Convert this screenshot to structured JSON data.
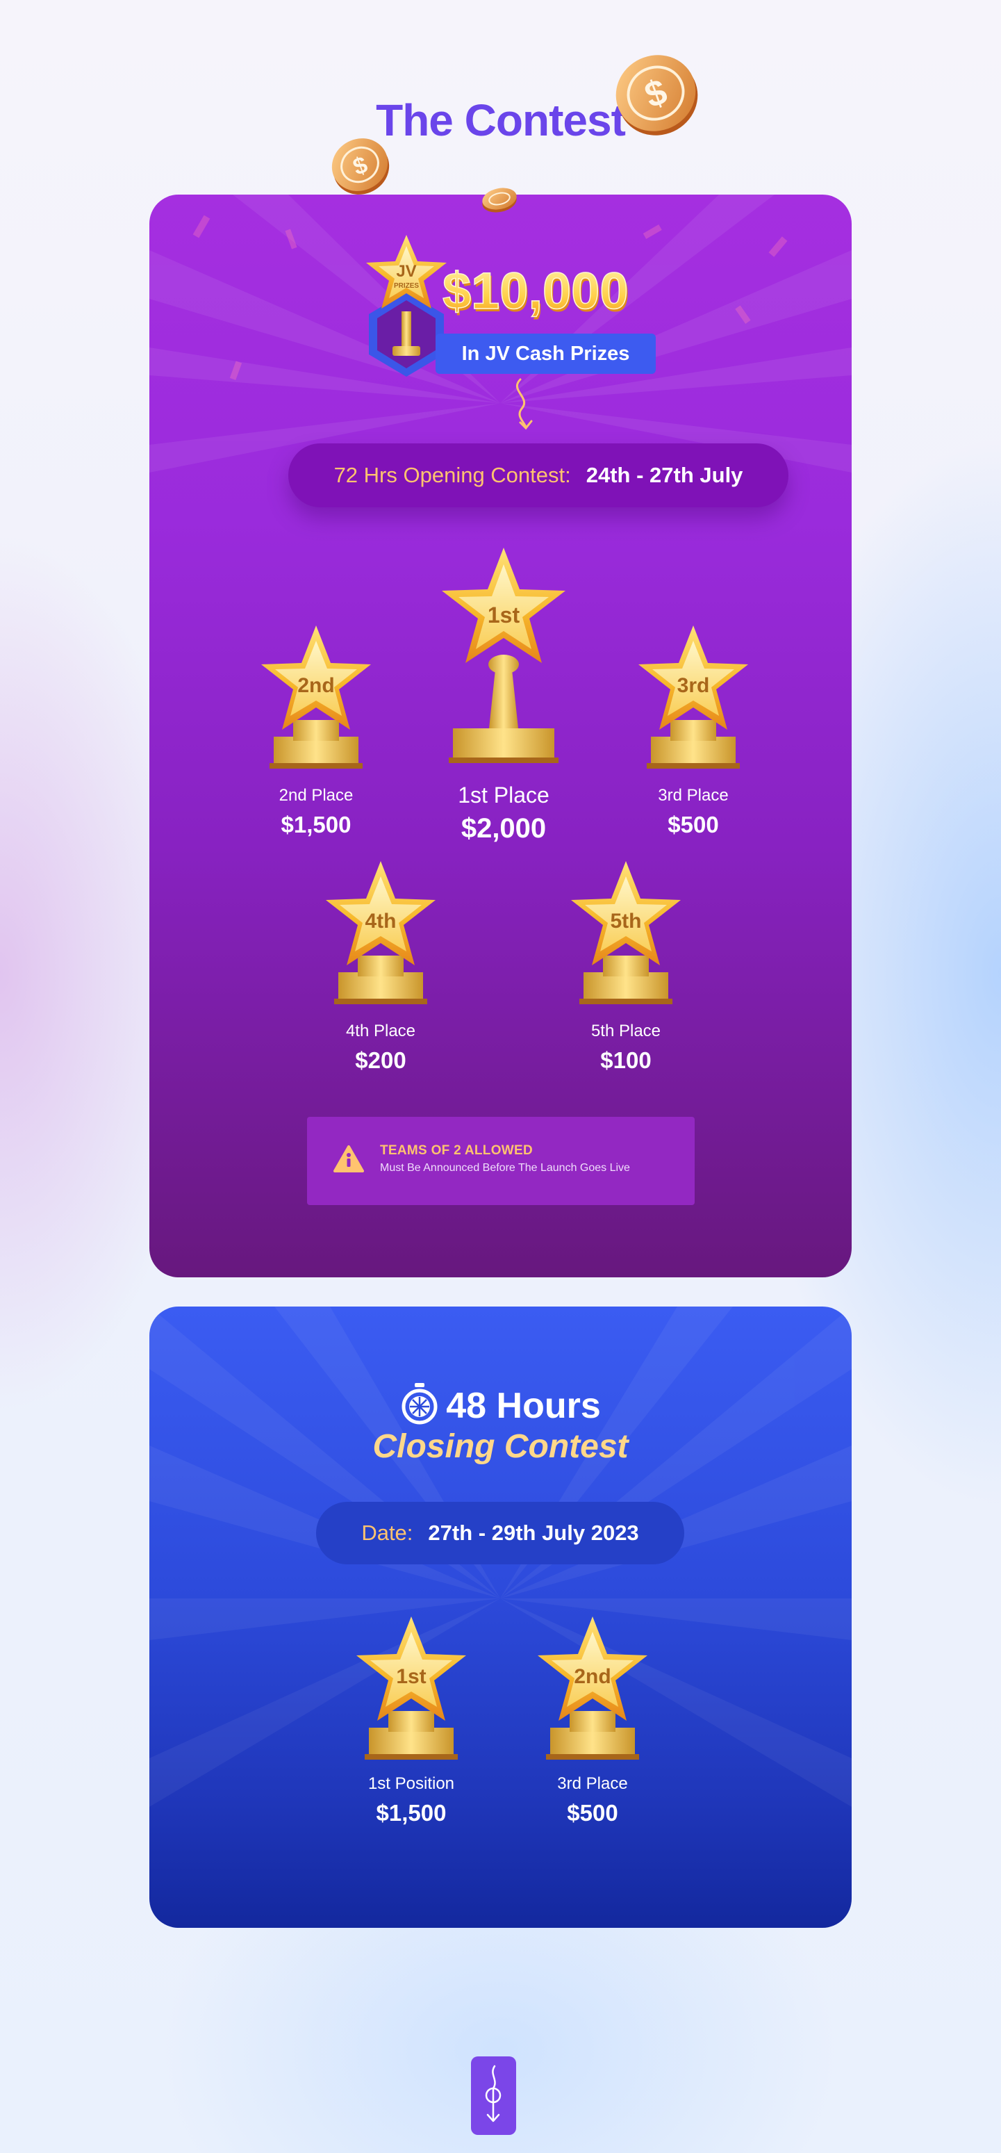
{
  "title": "The Contest",
  "opening": {
    "badge_line1": "JV",
    "badge_line2": "PRIZES",
    "prize_total": "$10,000",
    "prize_caption": "In JV Cash Prizes",
    "pill_label": "72 Hrs Opening Contest:",
    "pill_value": "24th - 27th July",
    "places": [
      {
        "badge": "1st",
        "label": "1st Place",
        "amount": "$2,000"
      },
      {
        "badge": "2nd",
        "label": "2nd Place",
        "amount": "$1,500"
      },
      {
        "badge": "3rd",
        "label": "3rd Place",
        "amount": "$500"
      },
      {
        "badge": "4th",
        "label": "4th Place",
        "amount": "$200"
      },
      {
        "badge": "5th",
        "label": "5th Place",
        "amount": "$100"
      }
    ],
    "notice_title": "TEAMS OF 2 ALLOWED",
    "notice_text": "Must Be Announced Before The Launch Goes Live"
  },
  "closing": {
    "hours": "48 Hours",
    "title": "Closing Contest",
    "pill_label": "Date:",
    "pill_value": "27th - 29th July 2023",
    "places": [
      {
        "badge": "1st",
        "label": "1st Position",
        "amount": "$1,500"
      },
      {
        "badge": "2nd",
        "label": "3rd Place",
        "amount": "$500"
      }
    ]
  },
  "icons": [
    "dollar-coin-icon",
    "stopwatch-icon",
    "warning-icon",
    "scroll-down-icon"
  ],
  "colors": {
    "title": "#6a45ea",
    "card_purple": "#9a2bdc",
    "card_blue": "#2d4bdc",
    "accent_gold": "#ffc36f",
    "gold": "#f5c030"
  }
}
